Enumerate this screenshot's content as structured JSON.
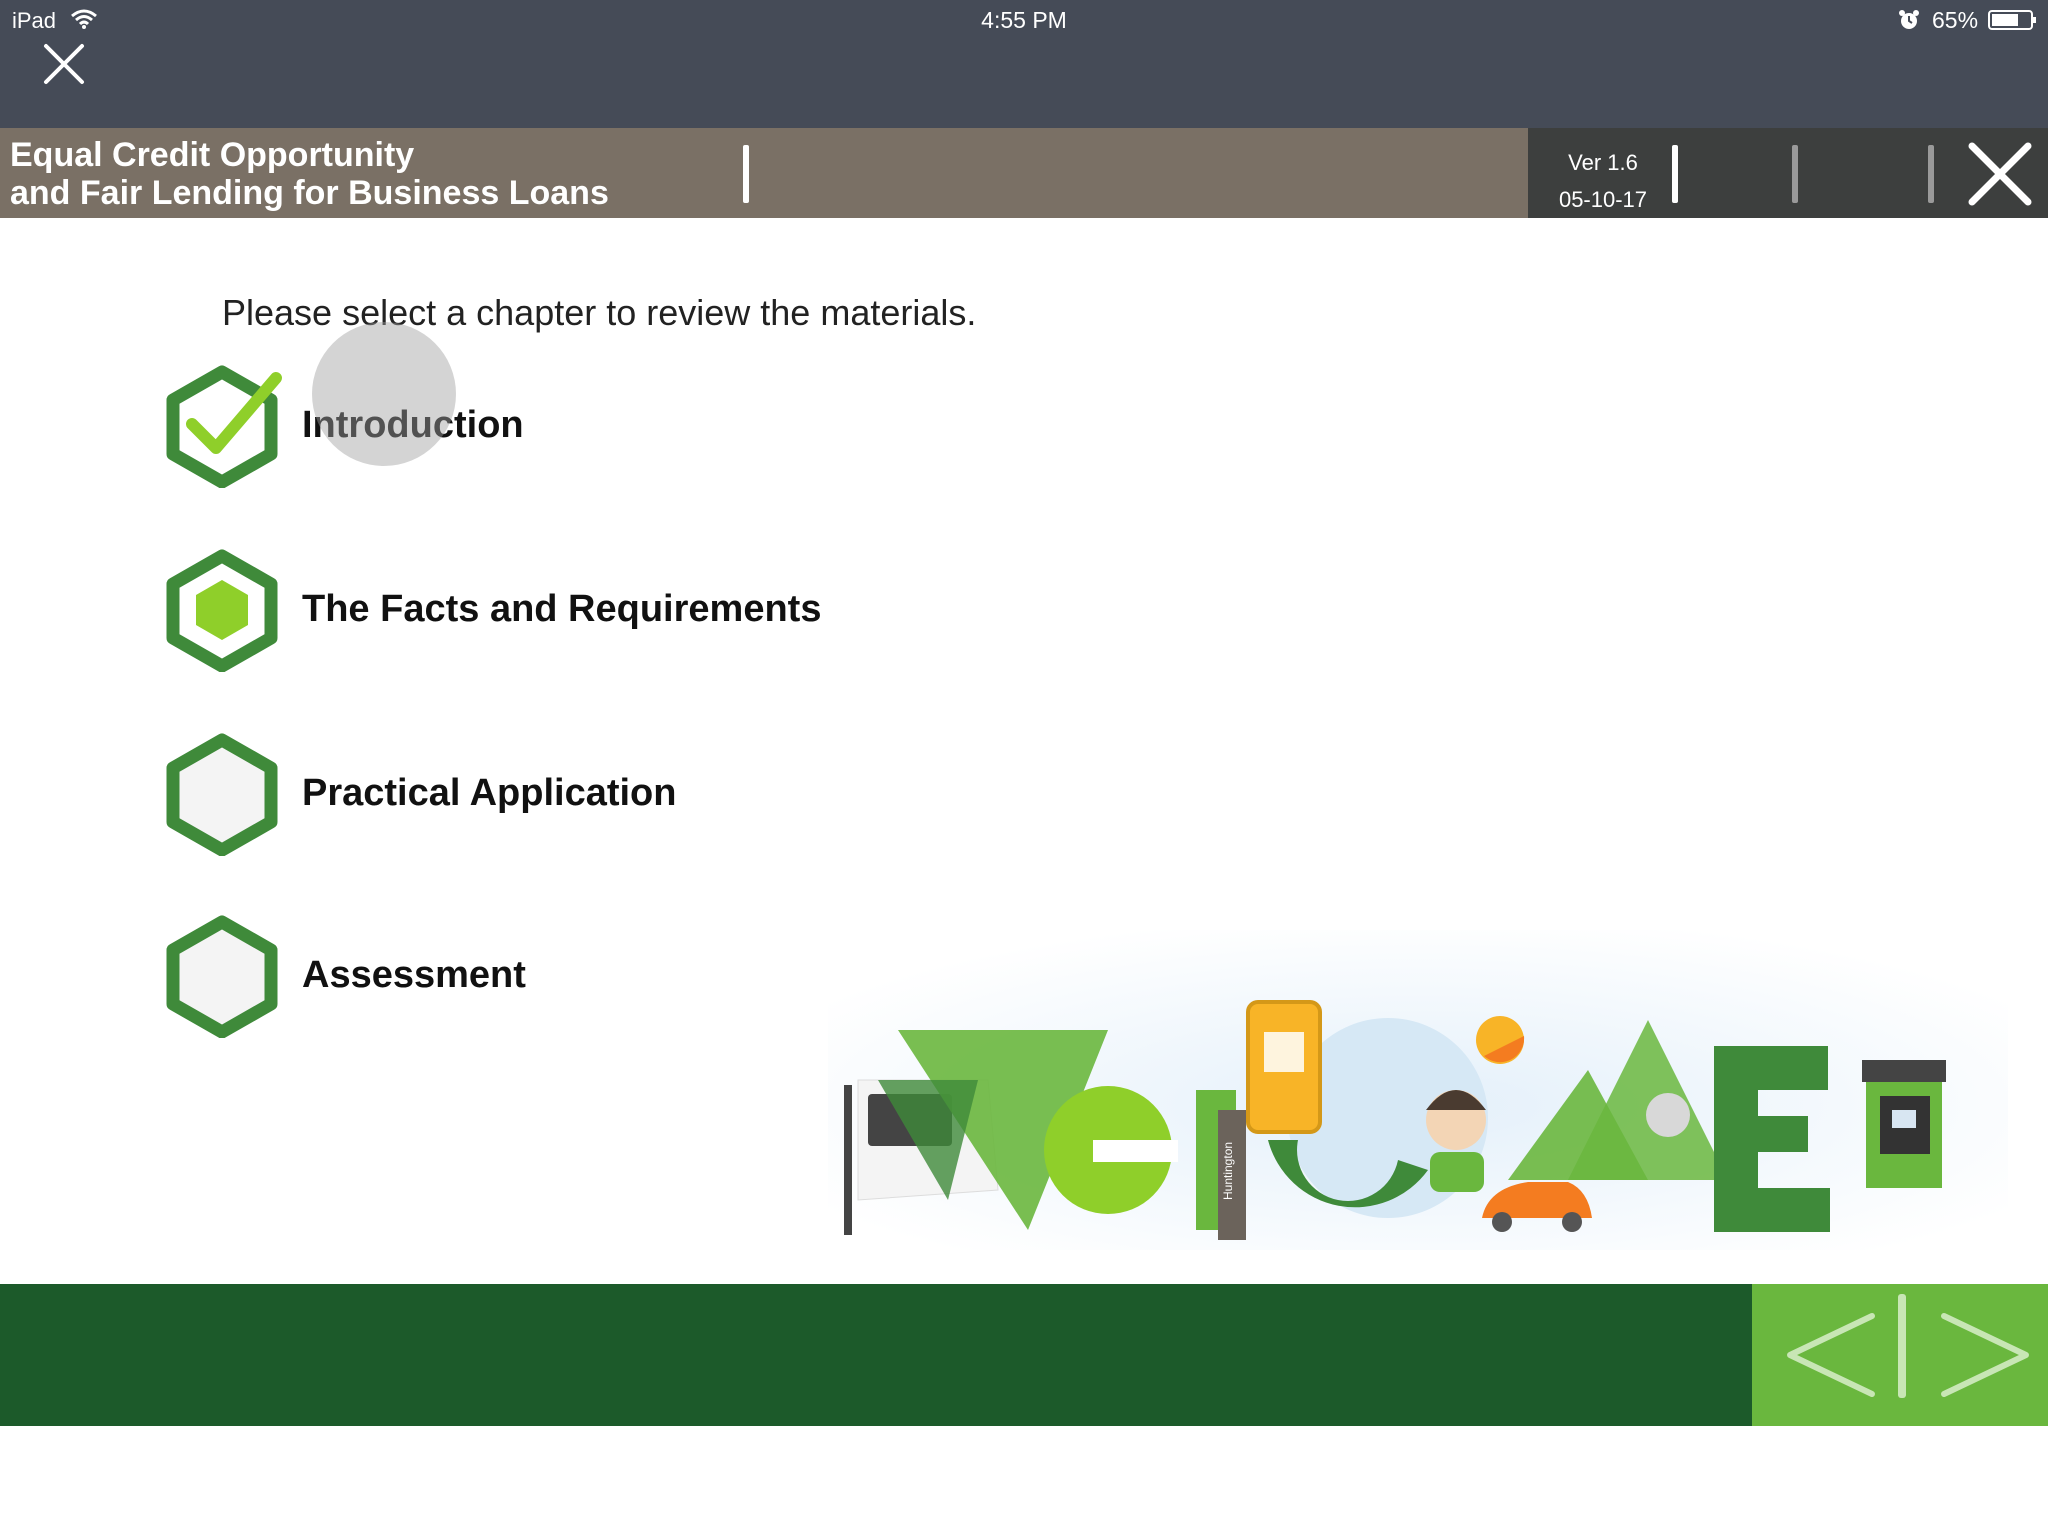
{
  "status_bar": {
    "device": "iPad",
    "time": "4:55 PM",
    "battery_percent": "65%",
    "icons": [
      "wifi-icon",
      "alarm-icon",
      "battery-icon"
    ]
  },
  "header": {
    "title_line1": "Equal Credit Opportunity",
    "title_line2": "and Fair Lending for Business Loans",
    "version": "Ver 1.6",
    "date": "05-10-17",
    "colors": {
      "title_bg": "#7a7065",
      "right_bg": "#3d3f3e"
    }
  },
  "main": {
    "instruction": "Please select a chapter to review the materials.",
    "chapters": [
      {
        "label": "Introduction",
        "status": "completed",
        "icon": "check-hexagon-icon"
      },
      {
        "label": "The Facts and Requirements",
        "status": "in-progress",
        "icon": "filled-hexagon-icon"
      },
      {
        "label": "Practical Application",
        "status": "not-started",
        "icon": "empty-hexagon-icon"
      },
      {
        "label": "Assessment",
        "status": "not-started",
        "icon": "empty-hexagon-icon"
      }
    ]
  },
  "illustration": {
    "name": "welcome-illustration",
    "sign_text": "Huntington"
  },
  "footer": {
    "nav_prev": "previous-arrow-icon",
    "nav_next": "next-arrow-icon",
    "colors": {
      "bar": "#1c5a2a",
      "nav": "#6ab73e"
    }
  }
}
